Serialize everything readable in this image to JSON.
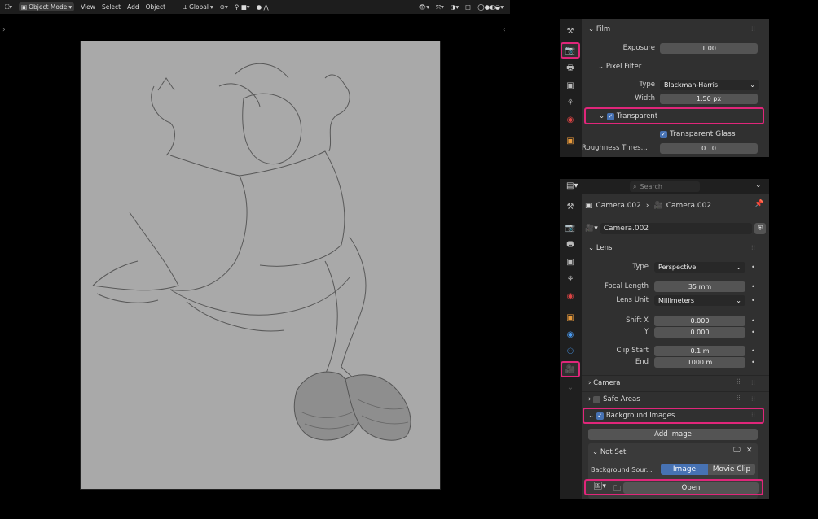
{
  "viewport": {
    "mode_label": "Object Mode",
    "menu": [
      "View",
      "Select",
      "Add",
      "Object"
    ],
    "transform_label": "Global"
  },
  "panel_top": {
    "film_label": "Film",
    "exposure_label": "Exposure",
    "exposure_value": "1.00",
    "pixel_filter_label": "Pixel Filter",
    "type_label": "Type",
    "type_value": "Blackman-Harris",
    "width_label": "Width",
    "width_value": "1.50 px",
    "transparent_label": "Transparent",
    "transparent_glass_label": "Transparent Glass",
    "roughness_label": "Roughness Thres...",
    "roughness_value": "0.10"
  },
  "panel_bottom": {
    "search_placeholder": "Search",
    "breadcrumb_object": "Camera.002",
    "breadcrumb_data": "Camera.002",
    "datablock_name": "Camera.002",
    "lens_label": "Lens",
    "type_label": "Type",
    "type_value": "Perspective",
    "focal_label": "Focal Length",
    "focal_value": "35 mm",
    "lens_unit_label": "Lens Unit",
    "lens_unit_value": "Millimeters",
    "shift_x_label": "Shift X",
    "shift_x_value": "0.000",
    "shift_y_label": "Y",
    "shift_y_value": "0.000",
    "clip_start_label": "Clip Start",
    "clip_start_value": "0.1 m",
    "clip_end_label": "End",
    "clip_end_value": "1000 m",
    "camera_label": "Camera",
    "safe_areas_label": "Safe Areas",
    "bg_images_label": "Background Images",
    "add_image_label": "Add Image",
    "not_set_label": "Not Set",
    "bg_source_label": "Background Sour...",
    "source_image_label": "Image",
    "source_movie_label": "Movie Clip",
    "open_label": "Open"
  },
  "colors": {
    "highlight": "#e0267a",
    "checkbox": "#4772b3",
    "active_tab_icon": "#4fd08a"
  }
}
